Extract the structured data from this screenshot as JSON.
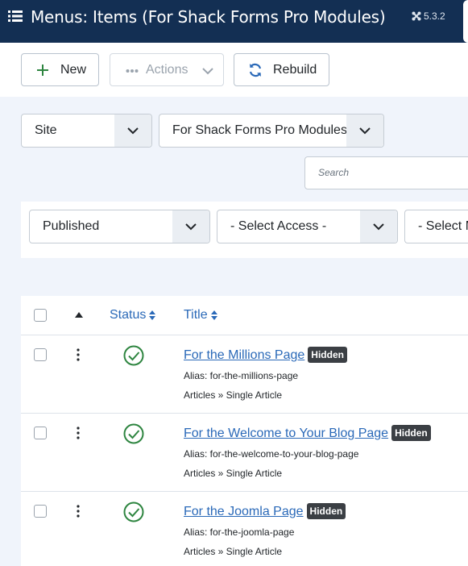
{
  "header": {
    "title": "Menus: Items (For Shack Forms Pro Modules)",
    "version": "5.3.2",
    "menu_icon": "hamburger-list-icon",
    "brand_icon": "joomla-icon"
  },
  "toolbar": {
    "new_label": "New",
    "actions_label": "Actions",
    "rebuild_label": "Rebuild"
  },
  "filters": {
    "client": "Site",
    "menu": "For Shack Forms Pro Modules",
    "search_placeholder": "Search",
    "published": "Published",
    "access": "- Select Access -",
    "third": "- Select M"
  },
  "table": {
    "headers": {
      "status": "Status",
      "title": "Title"
    },
    "rows": [
      {
        "title": "For the Millions Page",
        "badge": "Hidden",
        "alias": "Alias: for-the-millions-page",
        "type": "Articles » Single Article"
      },
      {
        "title": "For the Welcome to Your Blog Page",
        "badge": "Hidden",
        "alias": "Alias: for-the-welcome-to-your-blog-page",
        "type": "Articles » Single Article"
      },
      {
        "title": "For the Joomla Page",
        "badge": "Hidden",
        "alias": "Alias: for-the-joomla-page",
        "type": "Articles » Single Article"
      }
    ]
  },
  "colors": {
    "header_bg": "#132f53",
    "link": "#2a69b8",
    "success": "#2e8540",
    "badge_bg": "#3b3f44"
  }
}
